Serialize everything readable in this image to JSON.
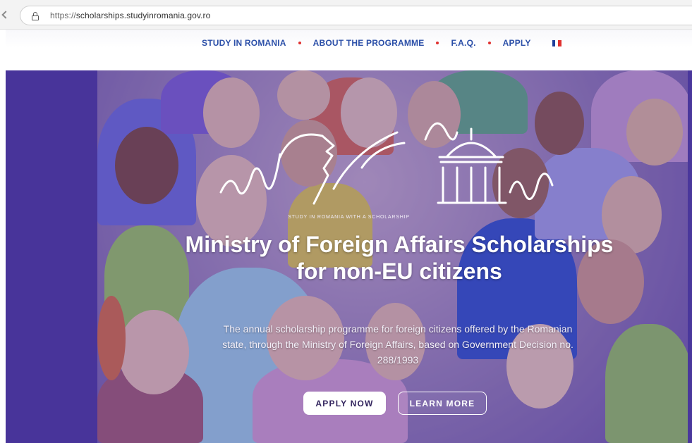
{
  "browser": {
    "url_scheme": "https://",
    "url_host": "scholarships.studyinromania.gov.ro"
  },
  "nav": {
    "items": [
      {
        "label": "STUDY IN ROMANIA"
      },
      {
        "label": "ABOUT THE PROGRAMME"
      },
      {
        "label": "F.A.Q."
      },
      {
        "label": "APPLY"
      }
    ],
    "language_icon": "flag-icon-france",
    "accent_dot_color": "#e0312f",
    "link_color": "#2b4fa8"
  },
  "hero": {
    "tagline": "STUDY IN ROMANIA WITH A SCHOLARSHIP",
    "title": "Ministry of Foreign Affairs Scholarships for non-EU citizens",
    "description": "The annual scholarship programme for foreign citizens offered by the Romanian state, through the Ministry of Foreign Affairs, based on Government Decision no. 288/1993",
    "primary_button": "APPLY NOW",
    "secondary_button": "LEARN MORE",
    "band_color": "#48349a"
  }
}
